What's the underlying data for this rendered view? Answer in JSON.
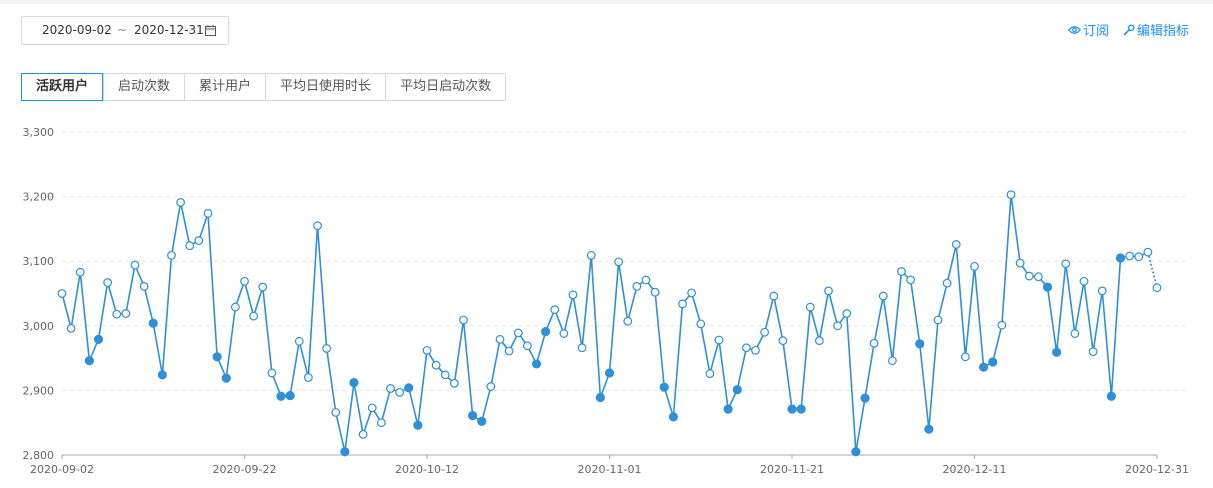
{
  "date_range": {
    "start": "2020-09-02",
    "separator": "~",
    "end": "2020-12-31"
  },
  "links": {
    "subscribe": "订阅",
    "edit": "编辑指标"
  },
  "tabs": [
    "活跃用户",
    "启动次数",
    "累计用户",
    "平均日使用时长",
    "平均日启动次数"
  ],
  "active_tab": 0,
  "colors": {
    "line": "#2f8fd8",
    "accent": "#1890ff",
    "grid": "#e8e8e8"
  },
  "chart_data": {
    "type": "line",
    "title": "",
    "xlabel": "",
    "ylabel": "",
    "ylim": [
      2800,
      3300
    ],
    "yticks": [
      "3,300",
      "3,200",
      "3,100",
      "3,000",
      "2,900",
      "2,800"
    ],
    "xtick_labels": [
      "2020-09-02",
      "2020-09-22",
      "2020-10-12",
      "2020-11-01",
      "2020-11-21",
      "2020-12-11",
      "2020-12-31"
    ],
    "grid": "horizontal-dashed",
    "x_start": "2020-09-02",
    "series": [
      {
        "values": [
          3050,
          2996,
          3083,
          2946,
          2979,
          3067,
          3018,
          3019,
          3094,
          3061,
          3004,
          2924,
          3109,
          3191,
          3124,
          3132,
          3174,
          2952,
          2919,
          3029,
          3069,
          3015,
          3060,
          2927,
          2891,
          2892,
          2976,
          2920,
          3155,
          2965,
          2866,
          2805,
          2912,
          2832,
          2873,
          2850,
          2903,
          2897,
          2904,
          2846,
          2962,
          2939,
          2924,
          2911,
          3009,
          2861,
          2852,
          2906,
          2979,
          2961,
          2989,
          2969,
          2941,
          2991,
          3025,
          2988,
          3048,
          2966,
          3109,
          2889,
          2927,
          3099,
          3007,
          3061,
          3071,
          3052,
          2905,
          2859,
          3034,
          3051,
          3003,
          2926,
          2978,
          2871,
          2901,
          2966,
          2962,
          2990,
          3046,
          2977,
          2871,
          2871,
          3029,
          2977,
          3054,
          3000,
          3019,
          2805,
          2888,
          2973,
          3046,
          2946,
          3084,
          3071,
          2972,
          2840,
          3009,
          3066,
          3126,
          2952,
          3092,
          2936,
          2944,
          3001,
          3203,
          3097,
          3077,
          3076,
          3060,
          2959,
          3096,
          2988,
          3069,
          2960,
          3054,
          2891,
          3105,
          3108,
          3107,
          3114,
          3059
        ],
        "marker_filled": [
          0,
          0,
          0,
          1,
          1,
          0,
          0,
          0,
          0,
          0,
          1,
          1,
          0,
          0,
          0,
          0,
          0,
          1,
          1,
          0,
          0,
          0,
          0,
          0,
          1,
          1,
          0,
          0,
          0,
          0,
          0,
          1,
          1,
          0,
          0,
          0,
          0,
          0,
          1,
          1,
          0,
          0,
          0,
          0,
          0,
          1,
          1,
          0,
          0,
          0,
          0,
          0,
          1,
          1,
          0,
          0,
          0,
          0,
          0,
          1,
          1,
          0,
          0,
          0,
          0,
          0,
          1,
          1,
          0,
          0,
          0,
          0,
          0,
          1,
          1,
          0,
          0,
          0,
          0,
          0,
          1,
          1,
          0,
          0,
          0,
          0,
          0,
          1,
          1,
          0,
          0,
          0,
          0,
          0,
          1,
          1,
          0,
          0,
          0,
          0,
          0,
          1,
          1,
          0,
          0,
          0,
          0,
          0,
          1,
          1,
          0,
          0,
          0,
          0,
          0,
          1,
          1,
          0,
          0,
          0,
          0
        ]
      }
    ]
  }
}
